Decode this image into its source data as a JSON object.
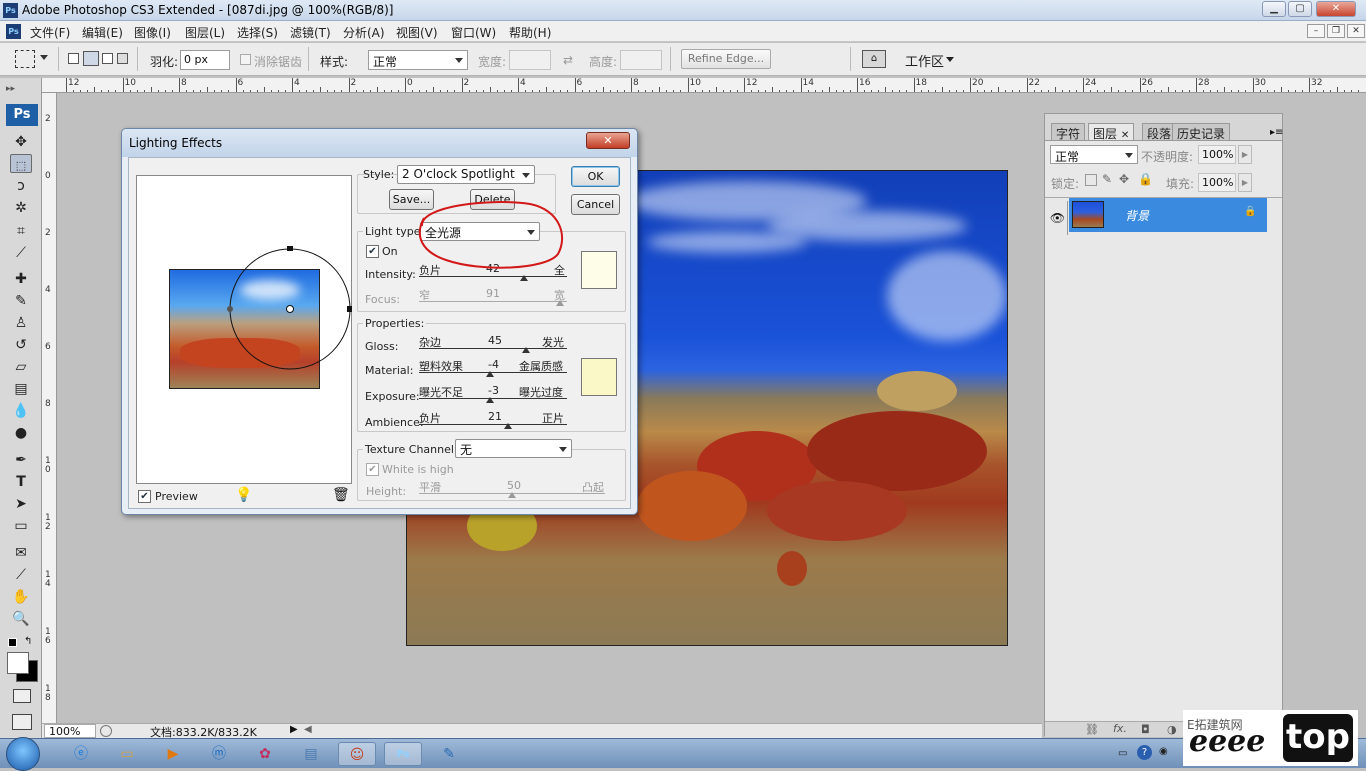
{
  "window": {
    "title": "Adobe Photoshop CS3 Extended - [087di.jpg @ 100%(RGB/8)]",
    "app_icon": "Ps",
    "minimize": "▁",
    "maximize": "▢",
    "close": "✕"
  },
  "menu": {
    "items": [
      "文件(F)",
      "编辑(E)",
      "图像(I)",
      "图层(L)",
      "选择(S)",
      "滤镜(T)",
      "分析(A)",
      "视图(V)",
      "窗口(W)",
      "帮助(H)"
    ],
    "mdi_minimize": "–",
    "mdi_restore": "❐",
    "mdi_close": "✕"
  },
  "options": {
    "feather_label": "羽化:",
    "feather_value": "0 px",
    "antialias_label": "消除锯齿",
    "style_label": "样式:",
    "style_value": "正常",
    "width_label": "宽度:",
    "height_label": "高度:",
    "refine_edge": "Refine Edge...",
    "workspace": "工作区"
  },
  "rulers": {
    "horizontal": [
      "12",
      "10",
      "8",
      "6",
      "4",
      "2",
      "0",
      "2",
      "4",
      "6",
      "8",
      "10",
      "12",
      "14",
      "16",
      "18",
      "20",
      "22",
      "24",
      "26",
      "28",
      "30",
      "32"
    ],
    "vertical": [
      "2",
      "0",
      "2",
      "4",
      "6",
      "8",
      "1 0",
      "1 2",
      "1 4",
      "1 6",
      "1 8"
    ]
  },
  "toolbox": {
    "logo": "Ps",
    "tools": [
      "move-tool",
      "marquee-tool",
      "lasso-tool",
      "magic-wand-tool",
      "crop-tool",
      "slice-tool",
      "healing-brush-tool",
      "brush-tool",
      "clone-stamp-tool",
      "history-brush-tool",
      "eraser-tool",
      "gradient-tool",
      "blur-tool",
      "dodge-tool",
      "pen-tool",
      "type-tool",
      "path-selection-tool",
      "shape-tool",
      "notes-tool",
      "eyedropper-tool",
      "hand-tool",
      "zoom-tool"
    ]
  },
  "status": {
    "zoom": "100%",
    "doc_info": "文档:833.2K/833.2K"
  },
  "dialog": {
    "title": "Lighting Effects",
    "close": "✕",
    "style_label": "Style:",
    "style_value": "2 O'clock Spotlight",
    "save": "Save...",
    "delete": "Delete",
    "ok": "OK",
    "cancel": "Cancel",
    "light_type_label": "Light type:",
    "light_type_value": "全光源",
    "on_label": "On",
    "intensity": {
      "label": "Intensity:",
      "left": "负片",
      "value": "42",
      "right": "全",
      "level": 0.71
    },
    "focus": {
      "label": "Focus:",
      "left": "窄",
      "value": "91",
      "right": "宽",
      "level": 0.95
    },
    "properties_label": "Properties:",
    "gloss": {
      "label": "Gloss:",
      "left": "杂边",
      "value": "45",
      "right": "发光",
      "level": 0.72
    },
    "material": {
      "label": "Material:",
      "left": "塑料效果",
      "value": "-4",
      "right": "金属质感",
      "level": 0.48
    },
    "exposure": {
      "label": "Exposure:",
      "left": "曝光不足",
      "value": "-3",
      "right": "曝光过度",
      "level": 0.48
    },
    "ambience": {
      "label": "Ambience:",
      "left": "负片",
      "value": "21",
      "right": "正片",
      "level": 0.6
    },
    "texture_label": "Texture Channel:",
    "texture_value": "无",
    "white_is_high": "White is high",
    "height": {
      "label": "Height:",
      "left": "平滑",
      "value": "50",
      "right": "凸起",
      "level": 0.5
    },
    "preview_label": "Preview",
    "light_color": "#fefde8",
    "property_color": "#fbf8c8"
  },
  "layers_panel": {
    "tabs": [
      "字符",
      "图层",
      "段落",
      "历史记录"
    ],
    "blend_mode": "正常",
    "opacity_label": "不透明度:",
    "opacity_value": "100%",
    "lock_label": "锁定:",
    "fill_label": "填充:",
    "fill_value": "100%",
    "layer_name": "背景"
  },
  "watermark": {
    "top": "E拓建筑网",
    "main": "eeee",
    "box": "top"
  }
}
